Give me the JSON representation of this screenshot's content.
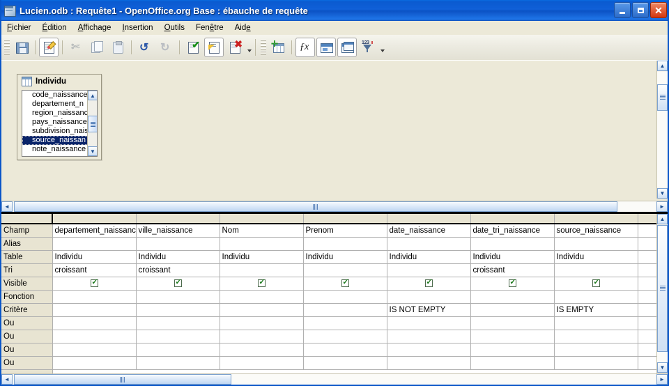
{
  "window": {
    "title": "Lucien.odb : Requête1  -  OpenOffice.org Base : ébauche de requête",
    "icon": "base-document-icon",
    "minimize_label": "Réduire",
    "maximize_label": "Agrandir",
    "close_label": "Fermer"
  },
  "menubar": {
    "items": [
      {
        "label": "Fichier",
        "accel": "F"
      },
      {
        "label": "Édition",
        "accel": "E"
      },
      {
        "label": "Affichage",
        "accel": "A"
      },
      {
        "label": "Insertion",
        "accel": "I"
      },
      {
        "label": "Outils",
        "accel": "O"
      },
      {
        "label": "Fenêtre",
        "accel": "ê"
      },
      {
        "label": "Aide",
        "accel": "e"
      }
    ]
  },
  "toolbar": {
    "buttons": [
      {
        "name": "save-button",
        "icon": "floppy-disk-icon",
        "state": "enabled"
      },
      {
        "name": "edit-button",
        "icon": "document-pencil-icon",
        "state": "active"
      },
      {
        "name": "cut-button",
        "icon": "scissors-icon",
        "state": "disabled"
      },
      {
        "name": "copy-button",
        "icon": "copy-pages-icon",
        "state": "disabled"
      },
      {
        "name": "paste-button",
        "icon": "clipboard-icon",
        "state": "disabled"
      },
      {
        "name": "undo-button",
        "icon": "undo-arrow-icon",
        "state": "enabled"
      },
      {
        "name": "redo-button",
        "icon": "redo-arrow-icon",
        "state": "disabled"
      },
      {
        "name": "run-query-button",
        "icon": "document-green-check-icon",
        "state": "enabled"
      },
      {
        "name": "design-view-button",
        "icon": "document-yellow-triangle-icon",
        "state": "active"
      },
      {
        "name": "clear-query-button",
        "icon": "document-red-cross-icon",
        "state": "enabled"
      },
      {
        "name": "add-table-button",
        "icon": "table-plus-icon",
        "state": "enabled"
      },
      {
        "name": "functions-button",
        "icon": "fx-icon",
        "state": "enabled"
      },
      {
        "name": "table-name-button",
        "icon": "window-bar-icon",
        "state": "enabled"
      },
      {
        "name": "alias-button",
        "icon": "window-overlap-icon",
        "state": "enabled"
      },
      {
        "name": "distinct-values-button",
        "icon": "numbered-funnel-icon",
        "state": "enabled"
      }
    ]
  },
  "design_pane": {
    "table_window": {
      "title": "Individu",
      "icon": "table-icon",
      "fields": [
        "code_naissance",
        "departement_n",
        "region_naissanc",
        "pays_naissance",
        "subdivision_nais",
        "source_naissan",
        "note_naissance"
      ],
      "selected_field": "source_naissan",
      "scroll_up": "▲",
      "scroll_down": "▼"
    },
    "scroll": {
      "up": "▲",
      "down": "▼",
      "left": "◄",
      "right": "►"
    }
  },
  "query_grid": {
    "row_labels": [
      "Champ",
      "Alias",
      "Table",
      "Tri",
      "Visible",
      "Fonction",
      "Critère",
      "Ou",
      "Ou",
      "Ou",
      "Ou"
    ],
    "columns": [
      {
        "champ": "departement_naissance",
        "alias": "",
        "table": "Individu",
        "tri": "croissant",
        "visible": true,
        "fonction": "",
        "critere": "",
        "ou": [
          "",
          "",
          "",
          ""
        ]
      },
      {
        "champ": "ville_naissance",
        "alias": "",
        "table": "Individu",
        "tri": "croissant",
        "visible": true,
        "fonction": "",
        "critere": "",
        "ou": [
          "",
          "",
          "",
          ""
        ]
      },
      {
        "champ": "Nom",
        "alias": "",
        "table": "Individu",
        "tri": "",
        "visible": true,
        "fonction": "",
        "critere": "",
        "ou": [
          "",
          "",
          "",
          ""
        ]
      },
      {
        "champ": "Prenom",
        "alias": "",
        "table": "Individu",
        "tri": "",
        "visible": true,
        "fonction": "",
        "critere": "",
        "ou": [
          "",
          "",
          "",
          ""
        ]
      },
      {
        "champ": "date_naissance",
        "alias": "",
        "table": "Individu",
        "tri": "",
        "visible": true,
        "fonction": "",
        "critere": "IS NOT EMPTY",
        "ou": [
          "",
          "",
          "",
          ""
        ]
      },
      {
        "champ": "date_tri_naissance",
        "alias": "",
        "table": "Individu",
        "tri": "croissant",
        "visible": true,
        "fonction": "",
        "critere": "",
        "ou": [
          "",
          "",
          "",
          ""
        ]
      },
      {
        "champ": "source_naissance",
        "alias": "",
        "table": "Individu",
        "tri": "",
        "visible": true,
        "fonction": "",
        "critere": "IS EMPTY",
        "ou": [
          "",
          "",
          "",
          ""
        ]
      },
      {
        "champ": "",
        "alias": "",
        "table": "",
        "tri": "",
        "visible": false,
        "fonction": "",
        "critere": "",
        "ou": [
          "",
          "",
          "",
          ""
        ]
      }
    ],
    "scroll": {
      "up": "▲",
      "down": "▼",
      "left": "◄",
      "right": "►"
    }
  },
  "colors": {
    "titlebar_blue": "#0a56c8",
    "menu_face": "#ece9d8",
    "grid_header": "#e8e4d2",
    "selection_blue": "#0a246a",
    "check_green": "#1c7a1c"
  }
}
